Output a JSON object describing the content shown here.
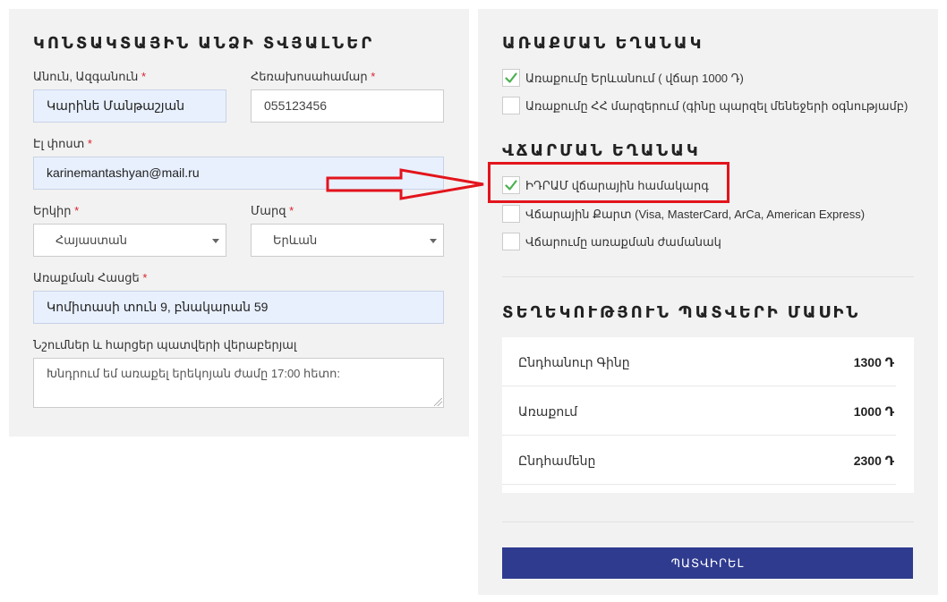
{
  "contact": {
    "title": "ԿՈՆՏԱԿՏԱՅԻՆ ԱՆՁԻ ՏՎՅԱԼՆԵՐ",
    "name": {
      "label": "Անուն, Ազգանուն",
      "required": "*",
      "value": "Կարինե Մանթաշյան"
    },
    "phone": {
      "label": "Հեռախոսահամար",
      "required": "*",
      "value": "055123456"
    },
    "email": {
      "label": "Էլ փոստ",
      "required": "*",
      "value": "karinemantashyan@mail.ru"
    },
    "country": {
      "label": "Երկիր",
      "required": "*",
      "value": "Հայաստան"
    },
    "region": {
      "label": "Մարզ",
      "required": "*",
      "value": "Երևան"
    },
    "address": {
      "label": "Առաքման Հասցե",
      "required": "*",
      "value": "Կոմիտասի տուն 9, բնակարան 59"
    },
    "notes": {
      "label": "Նշումներ և հարցեր պատվերի վերաբերյալ",
      "value": "Խնդրում եմ առաքել երեկոյան ժամը 17:00 հետո:"
    }
  },
  "delivery": {
    "title": "ԱՌԱՔՄԱՆ ԵՂԱՆԱԿ",
    "options": [
      {
        "label": "Առաքումը Երևանում ( վճար 1000 Դ)",
        "checked": true
      },
      {
        "label": "Առաքումը ՀՀ մարզերում (գինը պարզել մենեջերի օգնությամբ)",
        "checked": false
      }
    ]
  },
  "payment": {
    "title": "ՎՃԱՐՄԱՆ ԵՂԱՆԱԿ",
    "options": [
      {
        "label": "ԻԴՐԱՄ վճարային համակարգ",
        "checked": true
      },
      {
        "label": "Վճարային Քարտ (Visa, MasterCard, ArCa, American Express)",
        "checked": false
      },
      {
        "label": "Վճարումը առաքման ժամանակ",
        "checked": false
      }
    ]
  },
  "order_info": {
    "title": "ՏԵՂԵԿՈՒԹՅՈՒՆ ՊԱՏՎԵՐԻ ՄԱՍԻՆ",
    "rows": [
      {
        "label": "Ընդհանուր Գինը",
        "value": "1300 Դ"
      },
      {
        "label": "Առաքում",
        "value": "1000 Դ"
      },
      {
        "label": "Ընդհամենը",
        "value": "2300 Դ"
      }
    ]
  },
  "submit_label": "ՊԱՏՎԻՐԵԼ",
  "colors": {
    "accent": "#2f3b8f",
    "highlight": "#e3141c",
    "check": "#4caf50",
    "autofill": "#e8f0fe"
  }
}
